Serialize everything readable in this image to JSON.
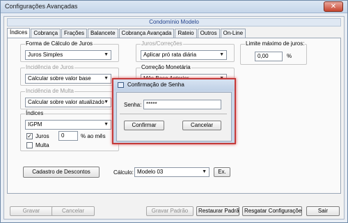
{
  "window": {
    "title": "Configurações Avançadas",
    "close_label": "✕"
  },
  "banner": {
    "title": "Condomínio Modelo"
  },
  "tabs": [
    {
      "label": "Índices",
      "active": true
    },
    {
      "label": "Cobrança"
    },
    {
      "label": "Frações"
    },
    {
      "label": "Balancete"
    },
    {
      "label": "Cobrança Avançada"
    },
    {
      "label": "Rateio"
    },
    {
      "label": "Outros"
    },
    {
      "label": "On-Line"
    }
  ],
  "forma_calculo": {
    "legend": "Forma de Cálculo de Juros",
    "value": "Juros Simples"
  },
  "incidencia_juros": {
    "legend": "Incidência de Juros",
    "value": "Calcular sobre valor base"
  },
  "incidencia_multa": {
    "legend": "Incidência de Multa",
    "value": "Calcular sobre valor atualizado"
  },
  "juros_correcoes": {
    "legend": "Juros/Correções",
    "value": "Aplicar pró rata diária"
  },
  "correcao_monetaria": {
    "legend": "Correção Monetária",
    "value": "Mês Base Anterior"
  },
  "limite_juros": {
    "legend": "Limite máximo de juros:",
    "value": "0,00",
    "unit": "%"
  },
  "indices": {
    "legend": "Índices",
    "value": "IGPM",
    "juros_label": "Juros",
    "juros_checked": true,
    "juros_value": "0",
    "juros_unit": "% ao mês",
    "multa_label": "Multa",
    "multa_checked": false
  },
  "cadastro_button": "Cadastro de Descontos",
  "calculo": {
    "label": "Cálculo:",
    "value": "Modelo 03",
    "ex_button": "Ex."
  },
  "dialog": {
    "title": "Confirmação de Senha",
    "senha_label": "Senha:",
    "senha_value": "*****",
    "confirm_button": "Confirmar",
    "cancel_button": "Cancelar"
  },
  "bottom": {
    "gravar": "Gravar",
    "cancelar": "Cancelar",
    "gravar_padrao": "Gravar Padrão",
    "restaurar_padrao": "Restaurar Padrão",
    "resgatar": "Resgatar Configurações",
    "sair": "Sair"
  }
}
